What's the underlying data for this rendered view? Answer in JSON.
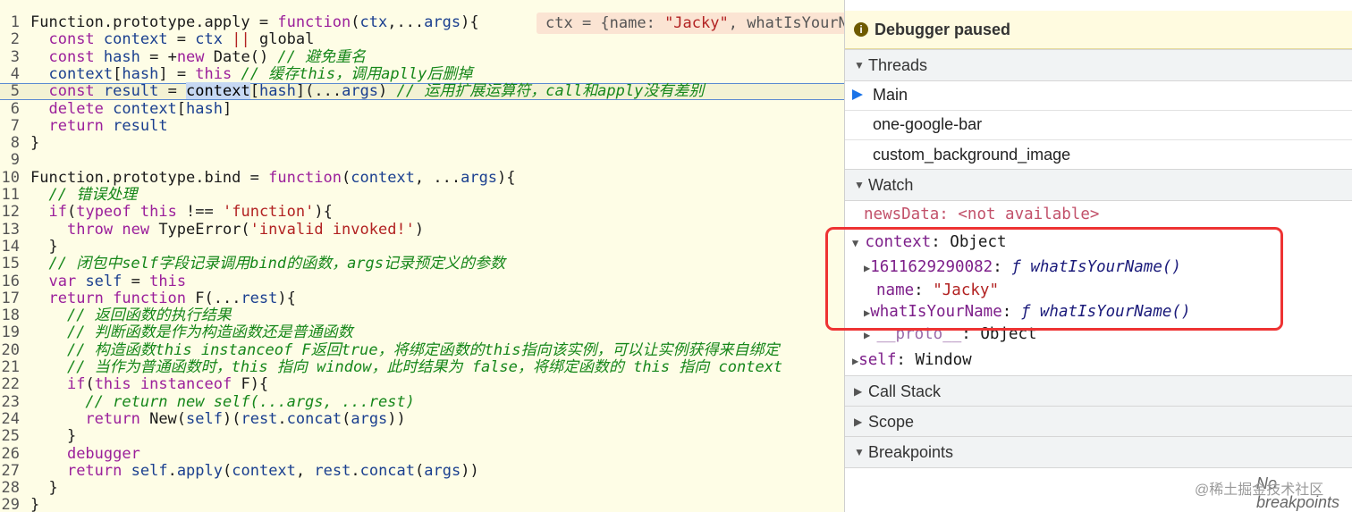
{
  "editor": {
    "inline_value": {
      "prefix": "ctx = {name: ",
      "str": "\"Jacky\"",
      "suffix": ", whatIsYourName"
    },
    "lines": [
      {
        "n": "1",
        "tokens": [
          [
            "pl",
            "Function.prototype.apply = "
          ],
          [
            "k",
            "function"
          ],
          [
            "pl",
            "("
          ],
          [
            "id",
            "ctx"
          ],
          [
            "pl",
            ",..."
          ],
          [
            "id",
            "args"
          ],
          [
            "pl",
            "){"
          ]
        ]
      },
      {
        "n": "2",
        "tokens": [
          [
            "pl",
            "  "
          ],
          [
            "k",
            "const "
          ],
          [
            "id",
            "context"
          ],
          [
            "pl",
            " = "
          ],
          [
            "id",
            "ctx"
          ],
          [
            "pl",
            " "
          ],
          [
            "str",
            "||"
          ],
          [
            "pl",
            " global"
          ]
        ]
      },
      {
        "n": "3",
        "tokens": [
          [
            "pl",
            "  "
          ],
          [
            "k",
            "const "
          ],
          [
            "id",
            "hash"
          ],
          [
            "pl",
            " = +"
          ],
          [
            "k",
            "new"
          ],
          [
            "pl",
            " Date() "
          ],
          [
            "cm",
            "// 避免重名"
          ]
        ]
      },
      {
        "n": "4",
        "tokens": [
          [
            "pl",
            "  "
          ],
          [
            "id",
            "context"
          ],
          [
            "pl",
            "["
          ],
          [
            "id",
            "hash"
          ],
          [
            "pl",
            "] = "
          ],
          [
            "k",
            "this"
          ],
          [
            "pl",
            " "
          ],
          [
            "cm",
            "// 缓存this，调用aplly后删掉"
          ]
        ]
      },
      {
        "n": "5",
        "current": true,
        "tokens": [
          [
            "pl",
            "  "
          ],
          [
            "k",
            "const "
          ],
          [
            "id",
            "result"
          ],
          [
            "pl",
            " = "
          ],
          [
            "sel",
            "context"
          ],
          [
            "pl",
            "["
          ],
          [
            "id",
            "hash"
          ],
          [
            "pl",
            "](..."
          ],
          [
            "id",
            "args"
          ],
          [
            "pl",
            ") "
          ],
          [
            "cm",
            "// 运用扩展运算符，call和apply没有差别"
          ]
        ]
      },
      {
        "n": "6",
        "tokens": [
          [
            "pl",
            "  "
          ],
          [
            "k",
            "delete "
          ],
          [
            "id",
            "context"
          ],
          [
            "pl",
            "["
          ],
          [
            "id",
            "hash"
          ],
          [
            "pl",
            "]"
          ]
        ]
      },
      {
        "n": "7",
        "tokens": [
          [
            "pl",
            "  "
          ],
          [
            "k",
            "return "
          ],
          [
            "id",
            "result"
          ]
        ]
      },
      {
        "n": "8",
        "tokens": [
          [
            "pl",
            "}"
          ]
        ]
      },
      {
        "n": "9",
        "tokens": []
      },
      {
        "n": "10",
        "tokens": [
          [
            "pl",
            "Function.prototype.bind = "
          ],
          [
            "k",
            "function"
          ],
          [
            "pl",
            "("
          ],
          [
            "id",
            "context"
          ],
          [
            "pl",
            ", ..."
          ],
          [
            "id",
            "args"
          ],
          [
            "pl",
            "){"
          ]
        ]
      },
      {
        "n": "11",
        "tokens": [
          [
            "pl",
            "  "
          ],
          [
            "cm",
            "// 错误处理"
          ]
        ]
      },
      {
        "n": "12",
        "tokens": [
          [
            "pl",
            "  "
          ],
          [
            "k",
            "if"
          ],
          [
            "pl",
            "("
          ],
          [
            "k",
            "typeof this"
          ],
          [
            "pl",
            " !== "
          ],
          [
            "str",
            "'function'"
          ],
          [
            "pl",
            "){"
          ]
        ]
      },
      {
        "n": "13",
        "tokens": [
          [
            "pl",
            "    "
          ],
          [
            "k",
            "throw new "
          ],
          [
            "pl",
            "TypeError("
          ],
          [
            "str",
            "'invalid invoked!'"
          ],
          [
            "pl",
            ")"
          ]
        ]
      },
      {
        "n": "14",
        "tokens": [
          [
            "pl",
            "  }"
          ]
        ]
      },
      {
        "n": "15",
        "tokens": [
          [
            "pl",
            "  "
          ],
          [
            "cm",
            "// 闭包中self字段记录调用bind的函数，args记录预定义的参数"
          ]
        ]
      },
      {
        "n": "16",
        "tokens": [
          [
            "pl",
            "  "
          ],
          [
            "k",
            "var "
          ],
          [
            "id",
            "self"
          ],
          [
            "pl",
            " = "
          ],
          [
            "k",
            "this"
          ]
        ]
      },
      {
        "n": "17",
        "tokens": [
          [
            "pl",
            "  "
          ],
          [
            "k",
            "return function "
          ],
          [
            "pl",
            "F(..."
          ],
          [
            "id",
            "rest"
          ],
          [
            "pl",
            "){"
          ]
        ]
      },
      {
        "n": "18",
        "tokens": [
          [
            "pl",
            "    "
          ],
          [
            "cm",
            "// 返回函数的执行结果"
          ]
        ]
      },
      {
        "n": "19",
        "tokens": [
          [
            "pl",
            "    "
          ],
          [
            "cm",
            "// 判断函数是作为构造函数还是普通函数"
          ]
        ]
      },
      {
        "n": "20",
        "tokens": [
          [
            "pl",
            "    "
          ],
          [
            "cm",
            "// 构造函数this instanceof F返回true，将绑定函数的this指向该实例，可以让实例获得来自绑定"
          ]
        ]
      },
      {
        "n": "21",
        "tokens": [
          [
            "pl",
            "    "
          ],
          [
            "cm",
            "// 当作为普通函数时，this 指向 window，此时结果为 false，将绑定函数的 this 指向 context"
          ]
        ]
      },
      {
        "n": "22",
        "tokens": [
          [
            "pl",
            "    "
          ],
          [
            "k",
            "if"
          ],
          [
            "pl",
            "("
          ],
          [
            "k",
            "this instanceof "
          ],
          [
            "pl",
            "F){"
          ]
        ]
      },
      {
        "n": "23",
        "tokens": [
          [
            "pl",
            "      "
          ],
          [
            "cm",
            "// return new self(...args, ...rest)"
          ]
        ]
      },
      {
        "n": "24",
        "tokens": [
          [
            "pl",
            "      "
          ],
          [
            "k",
            "return "
          ],
          [
            "pl",
            "New("
          ],
          [
            "id",
            "self"
          ],
          [
            "pl",
            ")("
          ],
          [
            "id",
            "rest"
          ],
          [
            "pl",
            "."
          ],
          [
            "id",
            "concat"
          ],
          [
            "pl",
            "("
          ],
          [
            "id",
            "args"
          ],
          [
            "pl",
            "))"
          ]
        ]
      },
      {
        "n": "25",
        "tokens": [
          [
            "pl",
            "    }"
          ]
        ]
      },
      {
        "n": "26",
        "tokens": [
          [
            "pl",
            "    "
          ],
          [
            "k",
            "debugger"
          ]
        ]
      },
      {
        "n": "27",
        "tokens": [
          [
            "pl",
            "    "
          ],
          [
            "k",
            "return "
          ],
          [
            "id",
            "self"
          ],
          [
            "pl",
            "."
          ],
          [
            "id",
            "apply"
          ],
          [
            "pl",
            "("
          ],
          [
            "id",
            "context"
          ],
          [
            "pl",
            ", "
          ],
          [
            "id",
            "rest"
          ],
          [
            "pl",
            "."
          ],
          [
            "id",
            "concat"
          ],
          [
            "pl",
            "("
          ],
          [
            "id",
            "args"
          ],
          [
            "pl",
            "))"
          ]
        ]
      },
      {
        "n": "28",
        "tokens": [
          [
            "pl",
            "  }"
          ]
        ]
      },
      {
        "n": "29",
        "tokens": [
          [
            "pl",
            "}"
          ]
        ]
      }
    ]
  },
  "debugger": {
    "pause_icon": "info-icon",
    "pause_text": "Debugger paused",
    "threads_label": "Threads",
    "threads": [
      "Main",
      "one-google-bar",
      "custom_background_image"
    ],
    "watch_label": "Watch",
    "watch": {
      "news_key": "newsData",
      "news_val": "<not available>",
      "context_key": "context",
      "context_val": "Object",
      "hash_key": "1611629290082",
      "hash_val": "ƒ whatIsYourName()",
      "name_key": "name",
      "name_val": "\"Jacky\"",
      "fn_key": "whatIsYourName",
      "fn_val": "ƒ whatIsYourName()",
      "proto_key": "__proto__",
      "proto_val": "Object",
      "self_key": "self",
      "self_val": "Window"
    },
    "callstack_label": "Call Stack",
    "scope_label": "Scope",
    "breakpoints_label": "Breakpoints",
    "no_breakpoints": "No breakpoints"
  },
  "watermark": "@稀土掘金技术社区"
}
